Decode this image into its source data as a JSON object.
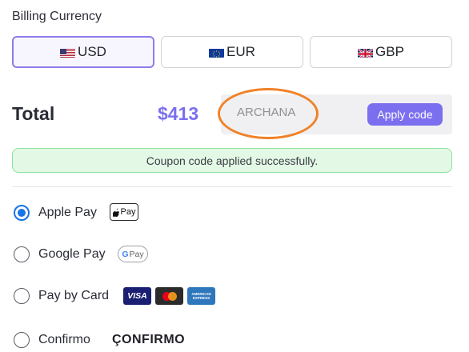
{
  "billing": {
    "title": "Billing Currency",
    "currencies": [
      {
        "label": "USD",
        "flag": "us-flag-icon",
        "selected": true
      },
      {
        "label": "EUR",
        "flag": "eu-flag-icon",
        "selected": false
      },
      {
        "label": "GBP",
        "flag": "uk-flag-icon",
        "selected": false
      }
    ]
  },
  "total": {
    "label": "Total",
    "amount": "$413"
  },
  "coupon": {
    "value": "ARCHANA",
    "apply_label": "Apply code",
    "success_message": "Coupon code applied successfully."
  },
  "payment_methods": [
    {
      "label": "Apple Pay",
      "checked": true,
      "badge": "Pay"
    },
    {
      "label": "Google Pay",
      "checked": false,
      "badge": "Pay"
    },
    {
      "label": "Pay by Card",
      "checked": false,
      "cards": [
        "VISA",
        "mastercard",
        "AMERICAN EXPRESS"
      ]
    },
    {
      "label": "Confirmo",
      "checked": false,
      "logo": "ÇONFIRMO"
    }
  ],
  "colors": {
    "accent": "#7b6ff0",
    "selected_border": "#8b7ee8",
    "success_bg": "#e3f9e5",
    "success_border": "#8fe0a0",
    "radio_checked": "#1a73e8",
    "highlight": "#f08228"
  }
}
